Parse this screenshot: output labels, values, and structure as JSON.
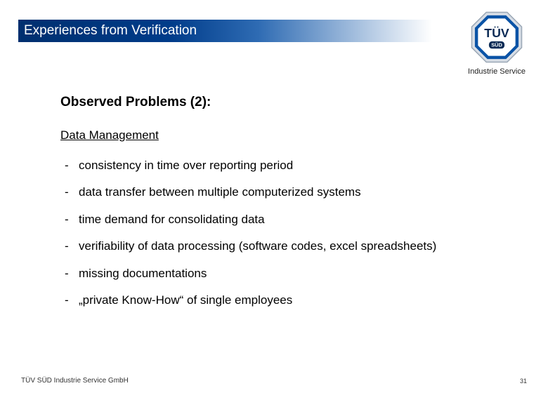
{
  "title": "Experiences from Verification",
  "logo": {
    "main": "TÜV",
    "sub": "SÜD",
    "division": "Industrie Service"
  },
  "content": {
    "heading": "Observed Problems (2):",
    "subheading": "Data Management",
    "bullets": [
      "consistency in time over reporting period",
      "data transfer between multiple computerized systems",
      "time demand for consolidating data",
      "verifiability of data processing (software codes, excel spreadsheets)",
      "missing documentations",
      "„private Know-How“ of single employees"
    ]
  },
  "footer": "TÜV SÜD Industrie Service GmbH",
  "page_number": "31",
  "colors": {
    "bar_start": "#002f6f",
    "bar_end": "#ffffff",
    "logo_blue": "#0a53a6",
    "logo_dark": "#1a2a44"
  }
}
